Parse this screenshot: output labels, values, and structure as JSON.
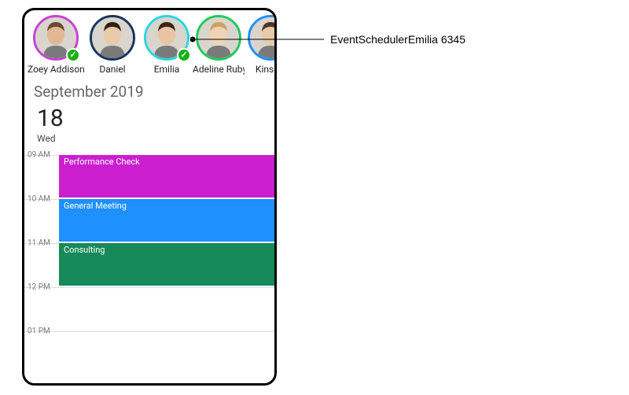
{
  "callout": {
    "label": "EventSchedulerEmilia 6345"
  },
  "resources": [
    {
      "name": "Zoey Addison",
      "ringColor": "#c642d4",
      "selected": true,
      "faceTone": "#e2b894",
      "hairColor": "#6a4a2e"
    },
    {
      "name": "Daniel",
      "ringColor": "#15365d",
      "selected": false,
      "faceTone": "#e8c9a8",
      "hairColor": "#2e2014"
    },
    {
      "name": "Emilia",
      "ringColor": "#28d6e0",
      "selected": true,
      "faceTone": "#e9c4a2",
      "hairColor": "#3a2418"
    },
    {
      "name": "Adeline Ruby",
      "ringColor": "#22c95e",
      "selected": false,
      "faceTone": "#efd3b4",
      "hairColor": "#caa560"
    },
    {
      "name": "Kinsley",
      "ringColor": "#1e90ff",
      "selected": false,
      "faceTone": "#e8c9a8",
      "hairColor": "#52361f"
    }
  ],
  "header": {
    "month": "September 2019",
    "dayNumber": "18",
    "dayName": "Wed"
  },
  "timeSlots": [
    "09 AM",
    "10 AM",
    "11 AM",
    "12 PM",
    "01 PM"
  ],
  "events": [
    {
      "title": "Performance Check",
      "startIndex": 0,
      "color": "#cb1fcf"
    },
    {
      "title": "General Meeting",
      "startIndex": 1,
      "color": "#1e90ff"
    },
    {
      "title": "Consulting",
      "startIndex": 2,
      "color": "#178a5a"
    }
  ],
  "layout": {
    "slotHeight": 56
  }
}
